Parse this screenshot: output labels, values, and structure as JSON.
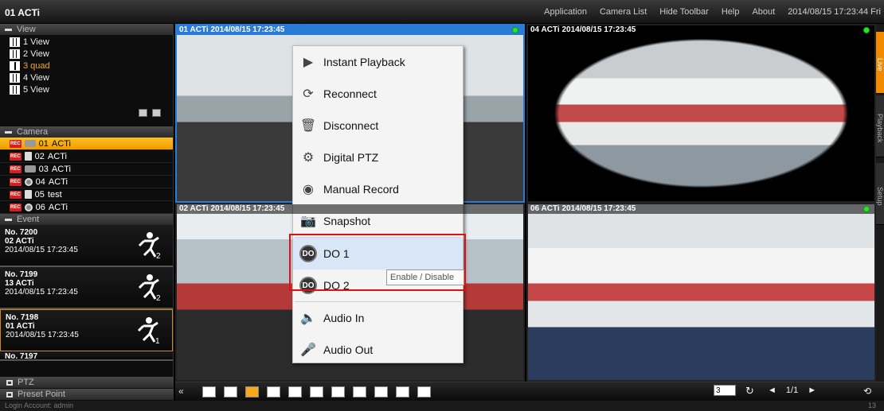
{
  "app_title": "01 ACTi",
  "top_menu": {
    "application": "Application",
    "camera_list": "Camera List",
    "hide_toolbar": "Hide Toolbar",
    "help": "Help",
    "about": "About",
    "datetime": "2014/08/15 17:23:44 Fri"
  },
  "view_section": {
    "header": "View",
    "items": [
      "1 View",
      "2 View",
      "3 quad",
      "4 View",
      "5 View"
    ],
    "active_index": 2
  },
  "camera_section": {
    "header": "Camera",
    "items": [
      {
        "num": "01",
        "name": "ACTi"
      },
      {
        "num": "02",
        "name": "ACTi"
      },
      {
        "num": "03",
        "name": "ACTi"
      },
      {
        "num": "04",
        "name": "ACTi"
      },
      {
        "num": "05",
        "name": "test"
      },
      {
        "num": "06",
        "name": "ACTi"
      }
    ],
    "rec_badge": "REC"
  },
  "event_section": {
    "header": "Event",
    "items": [
      {
        "no": "No. 7200",
        "cam": "02 ACTi",
        "time": "2014/08/15 17:23:45",
        "digit": "2"
      },
      {
        "no": "No. 7199",
        "cam": "13 ACTi",
        "time": "2014/08/15 17:23:45",
        "digit": "2"
      },
      {
        "no": "No. 7198",
        "cam": "01 ACTi",
        "time": "2014/08/15 17:23:45",
        "digit": "1"
      },
      {
        "no": "No. 7197",
        "cam": "",
        "time": "",
        "digit": ""
      }
    ]
  },
  "ptz_header": "PTZ",
  "preset_header": "Preset Point",
  "tiles": [
    {
      "title": "01 ACTi  2014/08/15 17:23:45"
    },
    {
      "title": "04 ACTi  2014/08/15 17:23:45"
    },
    {
      "title": "02 ACTi  2014/08/15 17:23:45"
    },
    {
      "title": "06 ACTi  2014/08/15 17:23:45"
    }
  ],
  "side_tabs": [
    "Live",
    "Playback",
    "Setup"
  ],
  "context_menu": {
    "items": [
      {
        "label": "Instant Playback",
        "icon": "play-icon"
      },
      {
        "label": "Reconnect",
        "icon": "reconnect-icon"
      },
      {
        "label": "Disconnect",
        "icon": "trash-icon"
      },
      {
        "label": "Digital PTZ",
        "icon": "gear-icon"
      },
      {
        "label": "Manual Record",
        "icon": "record-camera-icon"
      },
      {
        "label": "Snapshot",
        "icon": "camera-icon"
      },
      {
        "label": "DO 1",
        "icon": "do-icon"
      },
      {
        "label": "DO 2",
        "icon": "do-icon"
      },
      {
        "label": "Audio In",
        "icon": "speaker-icon"
      },
      {
        "label": "Audio Out",
        "icon": "microphone-icon"
      }
    ],
    "do_icon_text": "DO",
    "tooltip": "Enable / Disable"
  },
  "bottom_bar": {
    "collapse": "«",
    "page_input": "3",
    "page_indicator": "1/1",
    "prev": "◄",
    "next": "►"
  },
  "footer": {
    "login": "Login Account: admin",
    "right": "13"
  }
}
